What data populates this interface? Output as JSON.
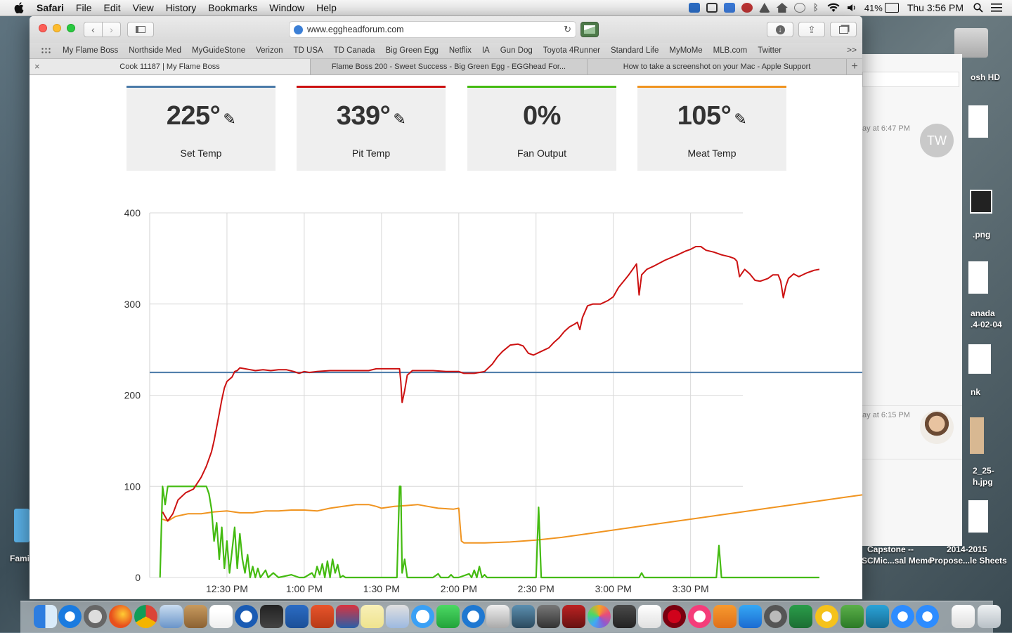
{
  "menubar": {
    "app": "Safari",
    "items": [
      "File",
      "Edit",
      "View",
      "History",
      "Bookmarks",
      "Window",
      "Help"
    ],
    "battery": "41%",
    "clock": "Thu 3:56 PM"
  },
  "browser": {
    "url": "www.eggheadforum.com",
    "favorites": [
      "My Flame Boss",
      "Northside Med",
      "MyGuideStone",
      "Verizon",
      "TD USA",
      "TD Canada",
      "Big Green Egg",
      "Netflix",
      "IA",
      "Gun Dog",
      "Toyota 4Runner",
      "Standard Life",
      "MyMoMe",
      "MLB.com",
      "Twitter"
    ],
    "favorites_more": ">>",
    "tabs": [
      {
        "title": "Cook 11187 | My Flame Boss",
        "active": true
      },
      {
        "title": "Flame Boss 200 - Sweet Success - Big Green Egg - EGGhead For...",
        "active": false
      },
      {
        "title": "How to take a screenshot on your Mac - Apple Support",
        "active": false
      }
    ]
  },
  "cards": [
    {
      "value": "225°",
      "label": "Set Temp",
      "color": "#4a7aa8",
      "editable": true
    },
    {
      "value": "339°",
      "label": "Pit Temp",
      "color": "#cc1111",
      "editable": true
    },
    {
      "value": "0%",
      "label": "Fan Output",
      "color": "#44bb11",
      "editable": false
    },
    {
      "value": "105°",
      "label": "Meat Temp",
      "color": "#f09420",
      "editable": true
    }
  ],
  "chart_data": {
    "type": "line",
    "title": "",
    "xlabel": "",
    "ylabel": "",
    "ylim": [
      0,
      400
    ],
    "yticks": [
      0,
      100,
      200,
      300,
      400
    ],
    "xlim_minutes": [
      0,
      345
    ],
    "xticks": [
      {
        "minute": 30,
        "label": "12:30 PM"
      },
      {
        "minute": 60,
        "label": "1:00 PM"
      },
      {
        "minute": 90,
        "label": "1:30 PM"
      },
      {
        "minute": 120,
        "label": "2:00 PM"
      },
      {
        "minute": 150,
        "label": "2:30 PM"
      },
      {
        "minute": 180,
        "label": "3:00 PM"
      },
      {
        "minute": 210,
        "label": "3:30 PM"
      }
    ],
    "grid": true,
    "series": [
      {
        "key": "set",
        "color": "#4a7aa8",
        "points": [
          [
            0,
            225
          ],
          [
            345,
            225
          ]
        ]
      },
      {
        "key": "pit",
        "color": "#cc1111",
        "points": [
          [
            5,
            72
          ],
          [
            7,
            62
          ],
          [
            9,
            70
          ],
          [
            11,
            85
          ],
          [
            14,
            93
          ],
          [
            17,
            97
          ],
          [
            20,
            110
          ],
          [
            22,
            122
          ],
          [
            24,
            138
          ],
          [
            25,
            150
          ],
          [
            26,
            165
          ],
          [
            27,
            180
          ],
          [
            28,
            195
          ],
          [
            29,
            208
          ],
          [
            30,
            215
          ],
          [
            32,
            220
          ],
          [
            33,
            226
          ],
          [
            34,
            227
          ],
          [
            35,
            230
          ],
          [
            37,
            229
          ],
          [
            39,
            228
          ],
          [
            41,
            227
          ],
          [
            44,
            228
          ],
          [
            47,
            227
          ],
          [
            50,
            228
          ],
          [
            53,
            228
          ],
          [
            56,
            226
          ],
          [
            58,
            224
          ],
          [
            60,
            226
          ],
          [
            62,
            225
          ],
          [
            65,
            226
          ],
          [
            70,
            227
          ],
          [
            75,
            227
          ],
          [
            80,
            227
          ],
          [
            85,
            227
          ],
          [
            88,
            229
          ],
          [
            90,
            229
          ],
          [
            94,
            229
          ],
          [
            97,
            229
          ],
          [
            97.5,
            215
          ],
          [
            98,
            192
          ],
          [
            99,
            205
          ],
          [
            100,
            222
          ],
          [
            102,
            227
          ],
          [
            105,
            227
          ],
          [
            110,
            227
          ],
          [
            115,
            226
          ],
          [
            120,
            226
          ],
          [
            122,
            224
          ],
          [
            126,
            224
          ],
          [
            130,
            226
          ],
          [
            133,
            234
          ],
          [
            135,
            242
          ],
          [
            137,
            248
          ],
          [
            140,
            255
          ],
          [
            143,
            256
          ],
          [
            145,
            254
          ],
          [
            147,
            246
          ],
          [
            149,
            244
          ],
          [
            152,
            248
          ],
          [
            155,
            252
          ],
          [
            157,
            258
          ],
          [
            159,
            263
          ],
          [
            161,
            270
          ],
          [
            163,
            275
          ],
          [
            165,
            278
          ],
          [
            166,
            280
          ],
          [
            167,
            272
          ],
          [
            168,
            285
          ],
          [
            170,
            298
          ],
          [
            172,
            300
          ],
          [
            175,
            300
          ],
          [
            178,
            304
          ],
          [
            180,
            308
          ],
          [
            182,
            318
          ],
          [
            184,
            325
          ],
          [
            186,
            332
          ],
          [
            188,
            340
          ],
          [
            189,
            344
          ],
          [
            190,
            310
          ],
          [
            191,
            332
          ],
          [
            193,
            338
          ],
          [
            196,
            342
          ],
          [
            200,
            348
          ],
          [
            205,
            354
          ],
          [
            208,
            358
          ],
          [
            210,
            360
          ],
          [
            212,
            363
          ],
          [
            214,
            363
          ],
          [
            216,
            359
          ],
          [
            219,
            357
          ],
          [
            222,
            354
          ],
          [
            225,
            352
          ],
          [
            227,
            350
          ],
          [
            228,
            347
          ],
          [
            229,
            330
          ],
          [
            231,
            338
          ],
          [
            233,
            333
          ],
          [
            235,
            326
          ],
          [
            237,
            325
          ],
          [
            240,
            328
          ],
          [
            242,
            332
          ],
          [
            244,
            332
          ],
          [
            245,
            325
          ],
          [
            246,
            307
          ],
          [
            247,
            320
          ],
          [
            248,
            328
          ],
          [
            250,
            333
          ],
          [
            252,
            330
          ],
          [
            255,
            334
          ],
          [
            257,
            336
          ],
          [
            258,
            337
          ],
          [
            260,
            338
          ]
        ]
      },
      {
        "key": "meat",
        "color": "#f09420",
        "points": [
          [
            5,
            64
          ],
          [
            7,
            62
          ],
          [
            10,
            67
          ],
          [
            15,
            70
          ],
          [
            20,
            70
          ],
          [
            25,
            72
          ],
          [
            30,
            73
          ],
          [
            35,
            71
          ],
          [
            40,
            71
          ],
          [
            45,
            73
          ],
          [
            50,
            73
          ],
          [
            55,
            74
          ],
          [
            60,
            74
          ],
          [
            65,
            73
          ],
          [
            70,
            76
          ],
          [
            75,
            78
          ],
          [
            80,
            80
          ],
          [
            85,
            80
          ],
          [
            88,
            78
          ],
          [
            90,
            76
          ],
          [
            95,
            78
          ],
          [
            100,
            79
          ],
          [
            104,
            80
          ],
          [
            108,
            78
          ],
          [
            110,
            77
          ],
          [
            112,
            76
          ],
          [
            118,
            75
          ],
          [
            120,
            76
          ],
          [
            121,
            40
          ],
          [
            122,
            38
          ],
          [
            125,
            38
          ],
          [
            130,
            38
          ],
          [
            140,
            39
          ],
          [
            150,
            41
          ],
          [
            160,
            44
          ],
          [
            170,
            48
          ],
          [
            180,
            52
          ],
          [
            190,
            56
          ],
          [
            200,
            60
          ],
          [
            210,
            64
          ],
          [
            220,
            68
          ],
          [
            230,
            72
          ],
          [
            240,
            76
          ],
          [
            250,
            80
          ],
          [
            260,
            84
          ],
          [
            270,
            88
          ],
          [
            280,
            92
          ],
          [
            290,
            96
          ],
          [
            300,
            99
          ],
          [
            310,
            102
          ],
          [
            320,
            105
          ]
        ]
      },
      {
        "key": "fan",
        "color": "#44bb11",
        "points": [
          [
            4,
            0
          ],
          [
            5,
            100
          ],
          [
            6,
            80
          ],
          [
            7,
            100
          ],
          [
            8,
            100
          ],
          [
            10,
            100
          ],
          [
            15,
            100
          ],
          [
            20,
            100
          ],
          [
            22,
            100
          ],
          [
            23,
            92
          ],
          [
            24,
            75
          ],
          [
            25,
            40
          ],
          [
            26,
            60
          ],
          [
            27,
            20
          ],
          [
            28,
            55
          ],
          [
            29,
            10
          ],
          [
            30,
            40
          ],
          [
            31,
            5
          ],
          [
            32,
            30
          ],
          [
            33,
            55
          ],
          [
            34,
            10
          ],
          [
            35,
            48
          ],
          [
            36,
            20
          ],
          [
            37,
            5
          ],
          [
            38,
            25
          ],
          [
            39,
            0
          ],
          [
            40,
            12
          ],
          [
            41,
            0
          ],
          [
            42,
            10
          ],
          [
            43,
            0
          ],
          [
            45,
            8
          ],
          [
            46,
            0
          ],
          [
            48,
            5
          ],
          [
            50,
            0
          ],
          [
            55,
            3
          ],
          [
            58,
            0
          ],
          [
            60,
            0
          ],
          [
            63,
            5
          ],
          [
            64,
            0
          ],
          [
            65,
            12
          ],
          [
            66,
            3
          ],
          [
            67,
            15
          ],
          [
            68,
            0
          ],
          [
            69,
            18
          ],
          [
            70,
            0
          ],
          [
            71,
            20
          ],
          [
            72,
            5
          ],
          [
            73,
            14
          ],
          [
            74,
            0
          ],
          [
            75,
            2
          ],
          [
            76,
            0
          ],
          [
            96,
            0
          ],
          [
            97,
            100
          ],
          [
            97.5,
            100
          ],
          [
            98,
            5
          ],
          [
            99,
            20
          ],
          [
            100,
            0
          ],
          [
            110,
            0
          ],
          [
            112,
            4
          ],
          [
            113,
            0
          ],
          [
            116,
            0
          ],
          [
            117,
            3
          ],
          [
            118,
            0
          ],
          [
            120,
            0
          ],
          [
            124,
            4
          ],
          [
            125,
            0
          ],
          [
            126,
            8
          ],
          [
            127,
            0
          ],
          [
            128,
            12
          ],
          [
            129,
            0
          ],
          [
            130,
            3
          ],
          [
            131,
            0
          ],
          [
            150,
            0
          ],
          [
            151,
            77
          ],
          [
            152,
            0
          ],
          [
            190,
            0
          ],
          [
            191,
            5
          ],
          [
            192,
            0
          ],
          [
            220,
            0
          ],
          [
            221,
            35
          ],
          [
            222,
            0
          ],
          [
            260,
            0
          ]
        ]
      }
    ]
  },
  "side_panel": {
    "msg1_time": "ay at 6:47 PM",
    "msg1_avatar": "TW",
    "msg2_time": "ay at 6:15 PM"
  },
  "desktop_labels": [
    {
      "text": "osh HD"
    },
    {
      "text": ".png"
    },
    {
      "text": "anada"
    },
    {
      "text": ".4-02-04"
    },
    {
      "text": "nk"
    },
    {
      "text": "2_25-"
    },
    {
      "text": "h.jpg"
    },
    {
      "text": "Capstone --"
    },
    {
      "text": "SCMic...sal Memo"
    },
    {
      "text": "2014-2015"
    },
    {
      "text": "Propose...le Sheets"
    },
    {
      "text": "Fami"
    }
  ]
}
